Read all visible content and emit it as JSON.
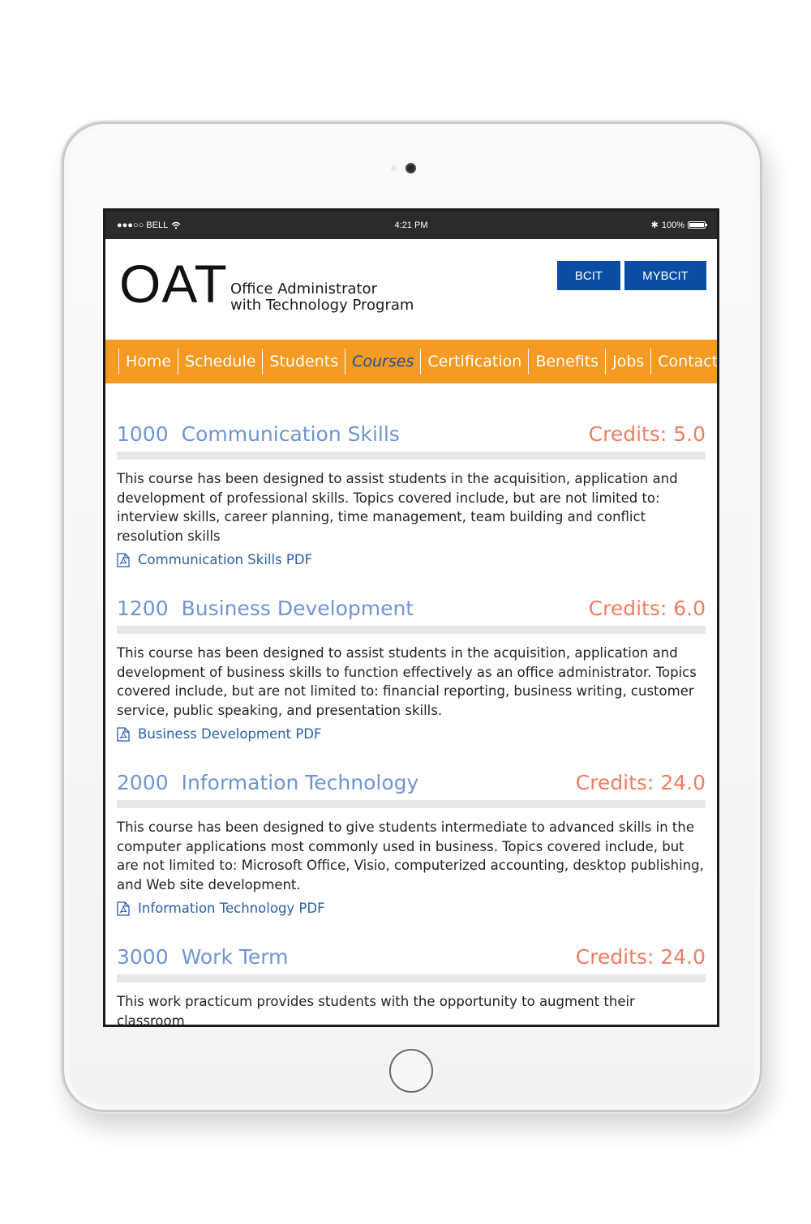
{
  "status_bar": {
    "carrier": "●●●○○ BELL",
    "wifi_icon": "wifi-icon",
    "time": "4:21 PM",
    "bluetooth": "✱",
    "battery": "100%"
  },
  "header": {
    "logo": "OAT",
    "subtitle_line1": "Office Administrator",
    "subtitle_line2": "with Technology Program",
    "buttons": {
      "bcit": "BCIT",
      "mybcit": "MYBCIT"
    }
  },
  "nav": {
    "items": [
      "Home",
      "Schedule",
      "Students",
      "Courses",
      "Certification",
      "Benefits",
      "Jobs",
      "Contact"
    ],
    "active": "Courses"
  },
  "courses": [
    {
      "number": "1000",
      "title": "Communication Skills",
      "credits": "Credits: 5.0",
      "description": "This course has been designed to assist students in the acquisition, application and development of professional skills. Topics covered include, but are not limited to: interview skills, career planning, time management, team building and conflict resolution skills",
      "pdf": "Communication Skills PDF"
    },
    {
      "number": "1200",
      "title": "Business Development",
      "credits": "Credits: 6.0",
      "description": "This course has been designed to assist students in the acquisition, application and development of business skills to function effectively as an office administrator. Topics covered include, but are not limited to: financial reporting, business writing, customer service, public speaking, and presentation skills.",
      "pdf": "Business Development PDF"
    },
    {
      "number": "2000",
      "title": "Information Technology",
      "credits": "Credits: 24.0",
      "description": "This course has been designed to give students intermediate to advanced skills in the computer applications most commonly used in business. Topics covered include, but are not limited to: Microsoft Office, Visio, computerized accounting, desktop publishing, and Web site development.",
      "pdf": "Information Technology PDF"
    },
    {
      "number": "3000",
      "title": "Work Term",
      "credits": "Credits: 24.0",
      "description": "This work practicum provides students with the opportunity to augment their classroom",
      "pdf": ""
    }
  ],
  "colors": {
    "nav_bg": "#f59a23",
    "button_bg": "#0a4da3",
    "course_title": "#6f95d2",
    "credits": "#ef7d62",
    "link": "#2a5fa8"
  }
}
